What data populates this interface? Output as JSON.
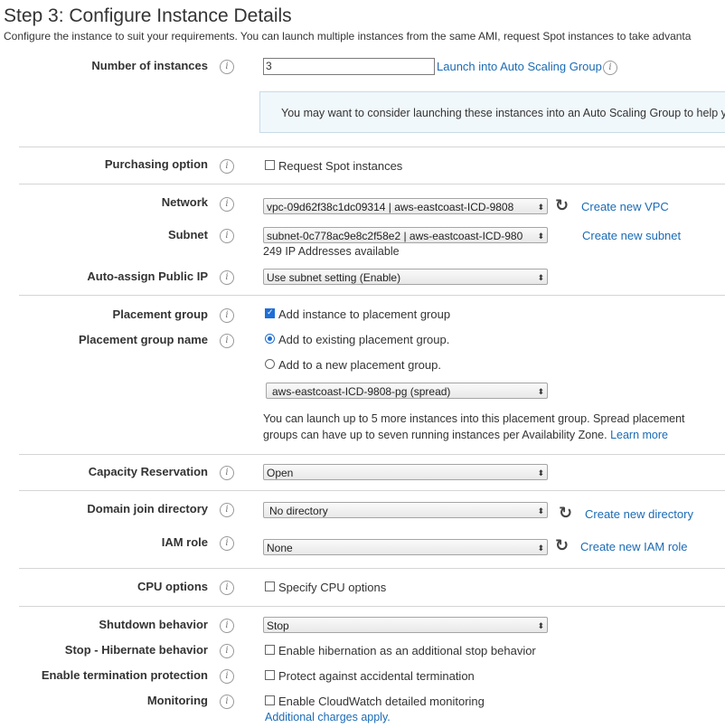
{
  "header": {
    "title": "Step 3: Configure Instance Details",
    "subtitle": "Configure the instance to suit your requirements. You can launch multiple instances from the same AMI, request Spot instances to take advanta"
  },
  "fields": {
    "number_of_instances": {
      "label": "Number of instances",
      "value": "3",
      "link": "Launch into Auto Scaling Group",
      "notice": "You may want to consider launching these instances into an Auto Scaling Group to help y"
    },
    "purchasing_option": {
      "label": "Purchasing option",
      "checkbox": "Request Spot instances",
      "checked": false
    },
    "network": {
      "label": "Network",
      "value": "vpc-09d62f38c1dc09314 | aws-eastcoast-ICD-9808",
      "link": "Create new VPC"
    },
    "subnet": {
      "label": "Subnet",
      "value": "subnet-0c778ac9e8c2f58e2 | aws-eastcoast-ICD-980",
      "link": "Create new subnet",
      "help": "249 IP Addresses available"
    },
    "auto_assign_ip": {
      "label": "Auto-assign Public IP",
      "value": "Use subnet setting (Enable)"
    },
    "placement_group": {
      "label": "Placement group",
      "checkbox": "Add instance to placement group",
      "checked": true
    },
    "placement_group_name": {
      "label": "Placement group name",
      "radio_existing": "Add to existing placement group.",
      "radio_new": "Add to a new placement group.",
      "value": "aws-eastcoast-ICD-9808-pg (spread)",
      "help_line1": "You can launch up to 5 more instances into this placement group. Spread placement",
      "help_line2": "groups can have up to seven running instances per Availability Zone.",
      "learn_more": "Learn more"
    },
    "capacity_reservation": {
      "label": "Capacity Reservation",
      "value": "Open"
    },
    "domain_join": {
      "label": "Domain join directory",
      "value": "No directory",
      "link": "Create new directory"
    },
    "iam_role": {
      "label": "IAM role",
      "value": "None",
      "link": "Create new IAM role"
    },
    "cpu_options": {
      "label": "CPU options",
      "checkbox": "Specify CPU options",
      "checked": false
    },
    "shutdown_behavior": {
      "label": "Shutdown behavior",
      "value": "Stop"
    },
    "stop_hibernate": {
      "label": "Stop - Hibernate behavior",
      "checkbox": "Enable hibernation as an additional stop behavior",
      "checked": false
    },
    "termination_protection": {
      "label": "Enable termination protection",
      "checkbox": "Protect against accidental termination",
      "checked": false
    },
    "monitoring": {
      "label": "Monitoring",
      "checkbox": "Enable CloudWatch detailed monitoring",
      "checked": false,
      "link": "Additional charges apply."
    }
  },
  "icons": {
    "info": "i",
    "select_arrow": "⬍",
    "refresh": "↻"
  }
}
